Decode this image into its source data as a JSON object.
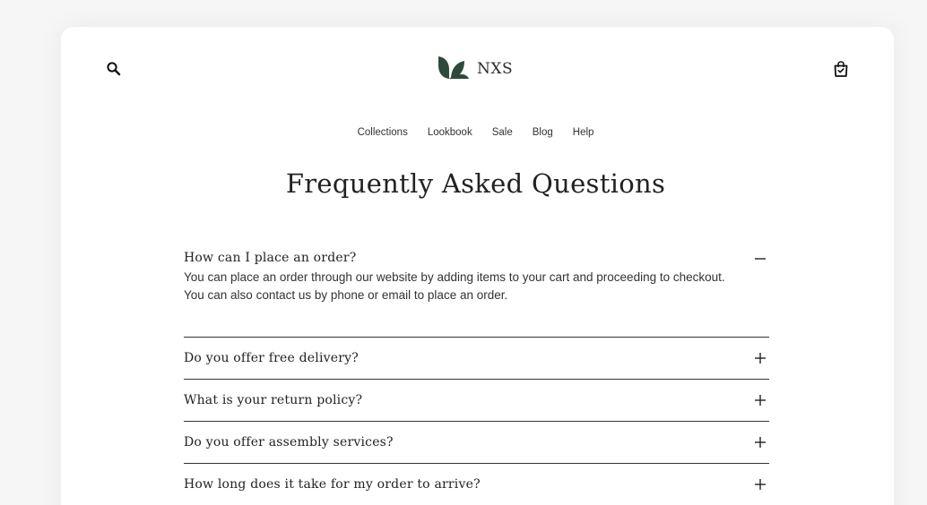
{
  "header": {
    "logo_text": "NXS",
    "search_icon": "search-icon",
    "cart_icon": "shopping-bag-icon"
  },
  "nav": {
    "items": [
      {
        "label": "Collections"
      },
      {
        "label": "Lookbook"
      },
      {
        "label": "Sale"
      },
      {
        "label": "Blog"
      },
      {
        "label": "Help"
      }
    ]
  },
  "page": {
    "title": "Frequently Asked Questions"
  },
  "faq": {
    "items": [
      {
        "question": "How can I place an order?",
        "answer": "You can place an order through our website by adding items to your cart and proceeding to checkout. You can also contact us by phone or email to place an order.",
        "expanded": true
      },
      {
        "question": "Do you offer free delivery?",
        "expanded": false
      },
      {
        "question": "What is your return policy?",
        "expanded": false
      },
      {
        "question": "Do you offer assembly services?",
        "expanded": false
      },
      {
        "question": "How long does it take for my order to arrive?",
        "expanded": false
      }
    ]
  },
  "colors": {
    "background": "#f6f6f6",
    "card": "#ffffff",
    "text": "#222222",
    "logo_mark": "#2e4a3c"
  }
}
